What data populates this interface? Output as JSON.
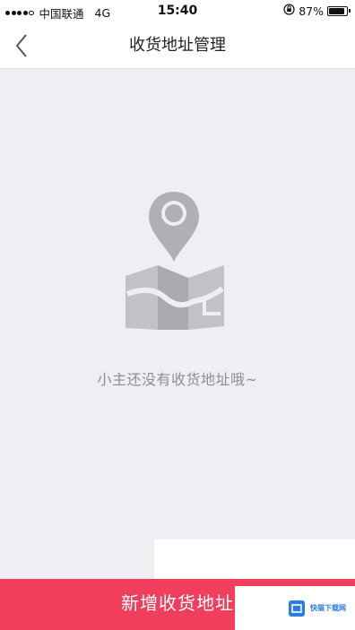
{
  "status_bar": {
    "carrier": "中国联通",
    "network": "4G",
    "time": "15:40",
    "battery_percent": "87%",
    "battery_level": 0.87
  },
  "nav": {
    "title": "收货地址管理",
    "back_icon": "chevron-left-icon"
  },
  "empty_state": {
    "illustration_icon": "map-pin-icon",
    "message": "小主还没有收货地址哦~"
  },
  "footer": {
    "add_button_label": "新增收货地址",
    "watermark_text": "快猫下载网"
  },
  "colors": {
    "accent": "#f03e5c",
    "background": "#efeff3",
    "illustration_gray": "#b7b7bb"
  }
}
